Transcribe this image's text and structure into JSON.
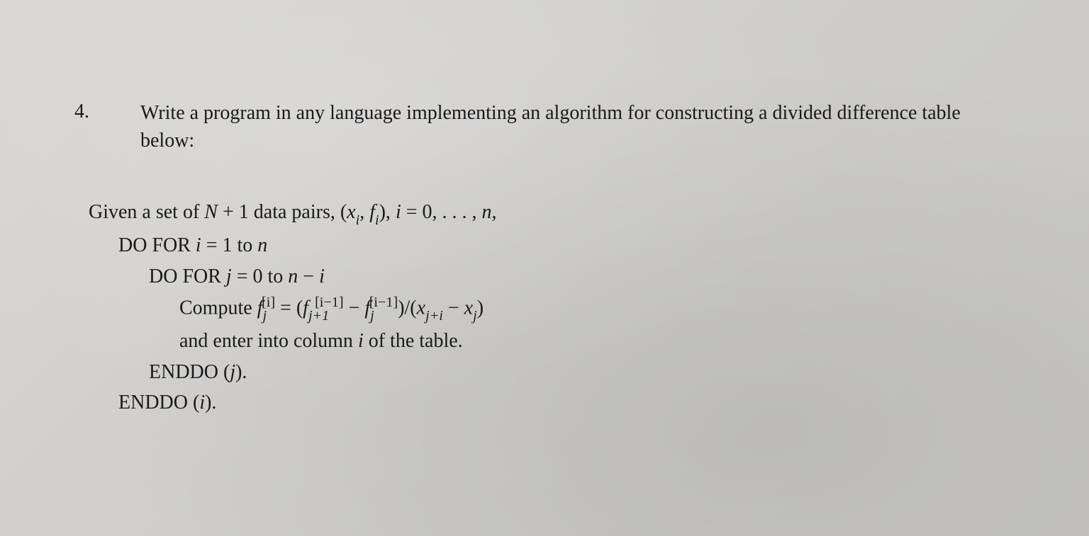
{
  "problem": {
    "number": "4.",
    "text": "Write a program in any language implementing an algorithm for constructing a divided difference table below:"
  },
  "algorithm": {
    "given_prefix": "Given a set of ",
    "given_expr_n": "N",
    "given_expr_plus": " + 1 data pairs, (",
    "given_x": "x",
    "given_comma": ", ",
    "given_f": "f",
    "given_close": "), ",
    "given_i": "i",
    "given_range": " = 0, . . . , ",
    "given_n": "n,",
    "sub_i": "i",
    "dofor_i_prefix": "DO FOR ",
    "dofor_i_var": "i",
    "dofor_i_range": " = 1 to ",
    "dofor_i_n": "n",
    "dofor_j_prefix": "DO FOR ",
    "dofor_j_var": "j",
    "dofor_j_range": " = 0 to ",
    "dofor_j_n": "n",
    "dofor_j_minus": " − ",
    "dofor_j_i": "i",
    "compute_prefix": "Compute ",
    "compute_f": "f",
    "compute_sup_i": "[i]",
    "compute_sub_j": "j",
    "compute_eq": " = (",
    "compute_f2": "f",
    "compute_sup_im1": "[i−1]",
    "compute_sub_jp1": "j+1",
    "compute_minus": " − ",
    "compute_f3": "f",
    "compute_sup_im1b": "[i−1]",
    "compute_sub_jb": "j",
    "compute_div": ")/(",
    "compute_x1": "x",
    "compute_sub_jpi": "j+i",
    "compute_minus2": " − ",
    "compute_x2": "x",
    "compute_sub_j2": "j",
    "compute_close": ")",
    "enter_text_prefix": "and enter into column ",
    "enter_text_i": "i",
    "enter_text_suffix": " of the table.",
    "enddo_j_prefix": "ENDDO (",
    "enddo_j_var": "j",
    "enddo_j_suffix": ").",
    "enddo_i_prefix": "ENDDO (",
    "enddo_i_var": "i",
    "enddo_i_suffix": ")."
  }
}
